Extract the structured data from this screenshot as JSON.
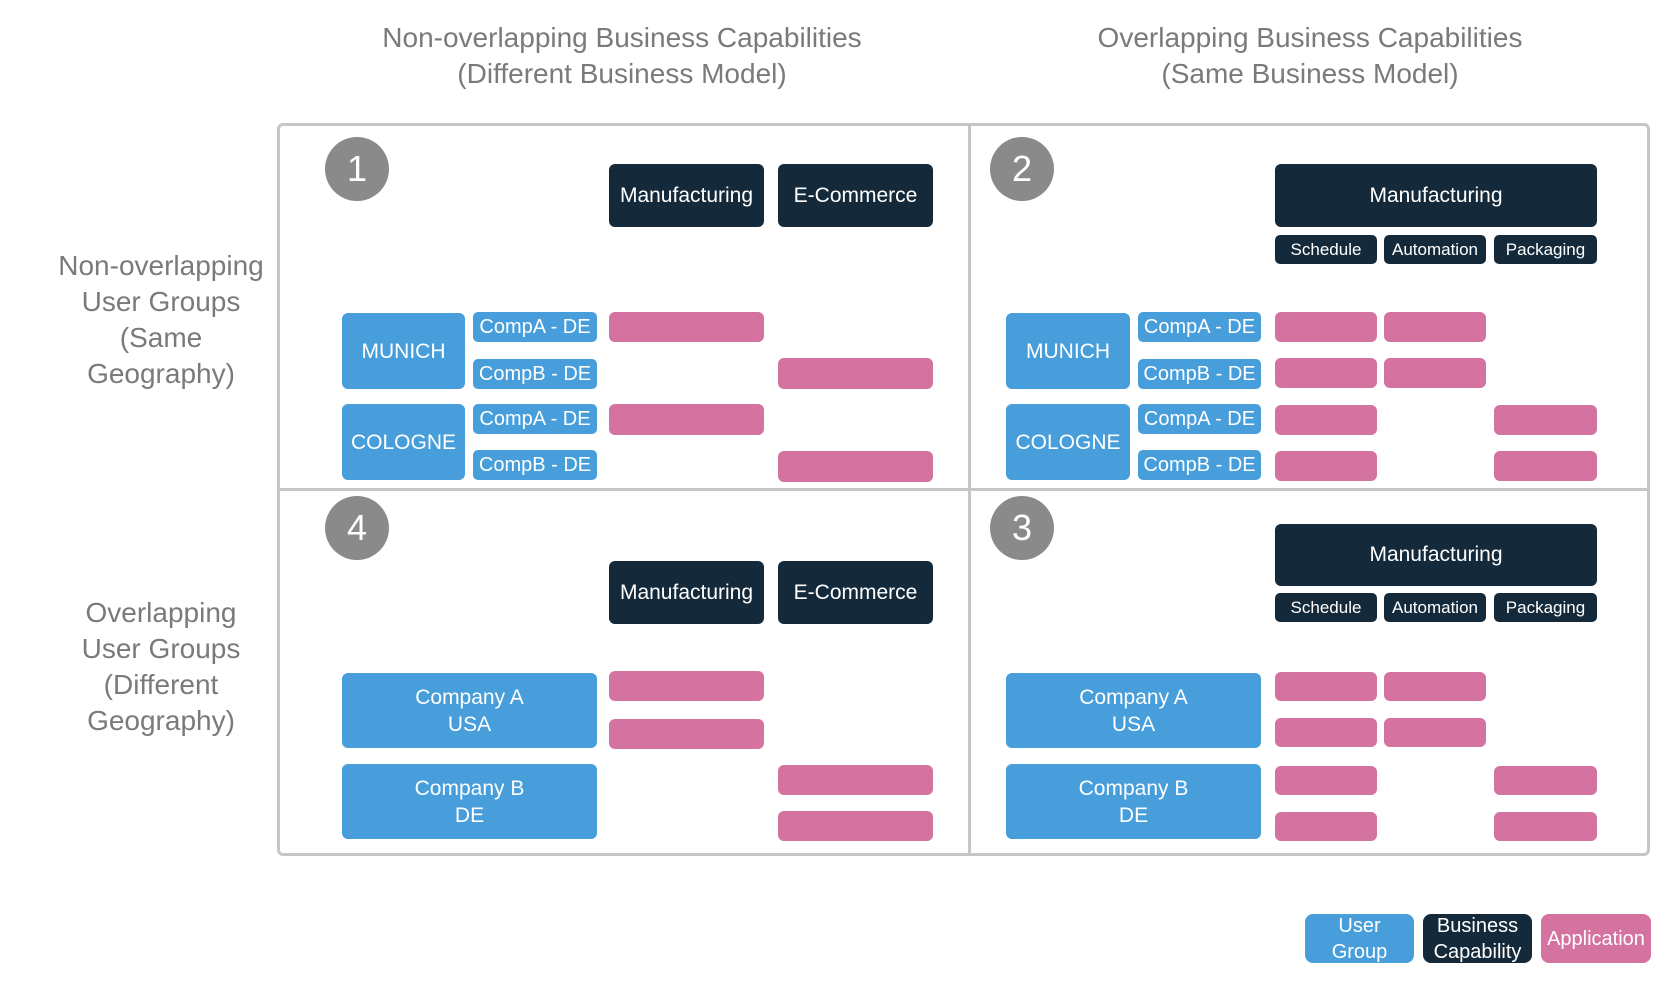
{
  "column_headers": [
    {
      "line1": "Non-overlapping Business Capabilities",
      "line2": "(Different Business Model)"
    },
    {
      "line1": "Overlapping Business Capabilities",
      "line2": "(Same Business Model)"
    }
  ],
  "row_headers": [
    {
      "lines": [
        "Non-overlapping",
        "User Groups",
        "(Same",
        "Geography)"
      ]
    },
    {
      "lines": [
        "Overlapping",
        "User Groups",
        "(Different",
        "Geography)"
      ]
    }
  ],
  "quadrants": {
    "q1": {
      "number": "1",
      "capabilities": [
        "Manufacturing",
        "E-Commerce"
      ],
      "user_groups": [
        {
          "name": "MUNICH",
          "subgroups": [
            "CompA - DE",
            "CompB - DE"
          ]
        },
        {
          "name": "COLOGNE",
          "subgroups": [
            "CompA - DE",
            "CompB - DE"
          ]
        }
      ]
    },
    "q2": {
      "number": "2",
      "capability": "Manufacturing",
      "sub_capabilities": [
        "Schedule",
        "Automation",
        "Packaging"
      ],
      "user_groups": [
        {
          "name": "MUNICH",
          "subgroups": [
            "CompA - DE",
            "CompB - DE"
          ]
        },
        {
          "name": "COLOGNE",
          "subgroups": [
            "CompA - DE",
            "CompB - DE"
          ]
        }
      ]
    },
    "q3": {
      "number": "3",
      "capability": "Manufacturing",
      "sub_capabilities": [
        "Schedule",
        "Automation",
        "Packaging"
      ],
      "user_groups": [
        {
          "line1": "Company A",
          "line2": "USA"
        },
        {
          "line1": "Company B",
          "line2": "DE"
        }
      ]
    },
    "q4": {
      "number": "4",
      "capabilities": [
        "Manufacturing",
        "E-Commerce"
      ],
      "user_groups": [
        {
          "line1": "Company A",
          "line2": "USA"
        },
        {
          "line1": "Company B",
          "line2": "DE"
        }
      ]
    }
  },
  "legend": {
    "user_group": {
      "line1": "User",
      "line2": "Group"
    },
    "business_capability": {
      "line1": "Business",
      "line2": "Capability"
    },
    "application": "Application"
  },
  "colors": {
    "user_group": "#479edb",
    "business_capability": "#142a3b",
    "application": "#d472a0",
    "badge": "#8a8a8a",
    "grid": "#c6c6c6",
    "header_text": "#7a7a7a"
  }
}
